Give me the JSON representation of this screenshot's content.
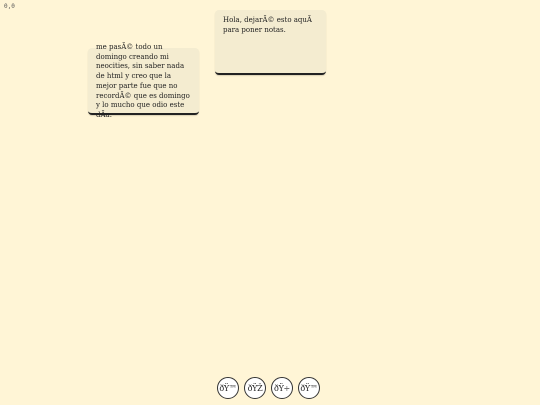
{
  "cursor_coords": "0,0",
  "notes": [
    {
      "text": "me pasÃ© todo un\ndomingo creando mi\nneocities, sin saber nada\nde html y creo que la\nmejor parte fue que no\nrecordÃ© que es domingo\ny lo mucho que odio este\ndÃ­a."
    },
    {
      "text": "Hola, dejarÃ© esto aquÃ­\npara poner notas."
    }
  ],
  "toolbar": {
    "buttons": [
      {
        "label": "ðŸ™",
        "icon": "tool-1-icon"
      },
      {
        "label": "ðŸŽ",
        "icon": "tool-2-icon"
      },
      {
        "label": "ðŸ÷",
        "icon": "tool-3-icon"
      },
      {
        "label": "ðŸ™",
        "icon": "tool-4-icon"
      }
    ]
  }
}
